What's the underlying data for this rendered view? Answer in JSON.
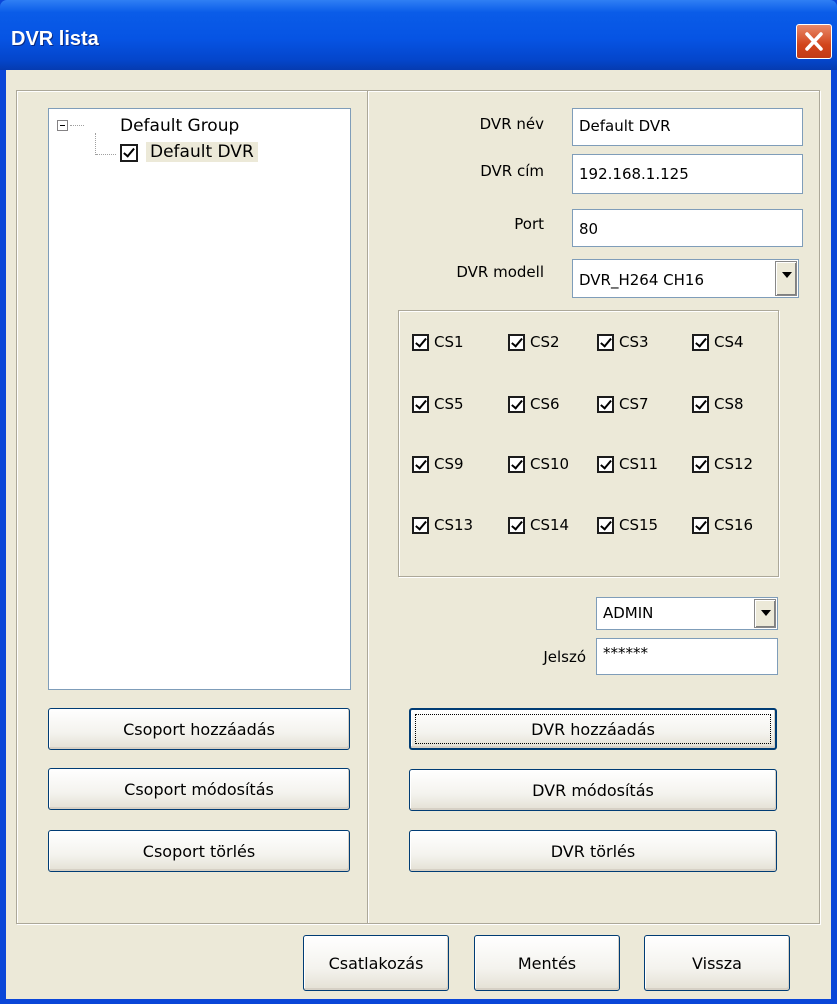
{
  "window": {
    "title": "DVR lista"
  },
  "tree": {
    "group": "Default Group",
    "dvr": "Default DVR"
  },
  "left_buttons": {
    "add_group": "Csoport hozzáadás",
    "modify_group": "Csoport módosítás",
    "delete_group": "Csoport törlés"
  },
  "form": {
    "name_label": "DVR név",
    "name_value": "Default DVR",
    "address_label": "DVR cím",
    "address_value": "192.168.1.125",
    "port_label": "Port",
    "port_value": "80",
    "model_label": "DVR modell",
    "model_value": "DVR_H264 CH16",
    "user_value": "ADMIN",
    "password_label": "Jelszó",
    "password_value": "******"
  },
  "channels": [
    {
      "label": "CS1",
      "checked": true
    },
    {
      "label": "CS2",
      "checked": true
    },
    {
      "label": "CS3",
      "checked": true
    },
    {
      "label": "CS4",
      "checked": true
    },
    {
      "label": "CS5",
      "checked": true
    },
    {
      "label": "CS6",
      "checked": true
    },
    {
      "label": "CS7",
      "checked": true
    },
    {
      "label": "CS8",
      "checked": true
    },
    {
      "label": "CS9",
      "checked": true
    },
    {
      "label": "CS10",
      "checked": true
    },
    {
      "label": "CS11",
      "checked": true
    },
    {
      "label": "CS12",
      "checked": true
    },
    {
      "label": "CS13",
      "checked": true
    },
    {
      "label": "CS14",
      "checked": true
    },
    {
      "label": "CS15",
      "checked": true
    },
    {
      "label": "CS16",
      "checked": true
    }
  ],
  "right_buttons": {
    "add_dvr": "DVR hozzáadás",
    "modify_dvr": "DVR módosítás",
    "delete_dvr": "DVR törlés"
  },
  "bottom_buttons": {
    "connect": "Csatlakozás",
    "save": "Mentés",
    "back": "Vissza"
  },
  "colors": {
    "title_bar": "#0654e4",
    "close_button": "#d2451c",
    "dialog_bg": "#ece9d8"
  }
}
